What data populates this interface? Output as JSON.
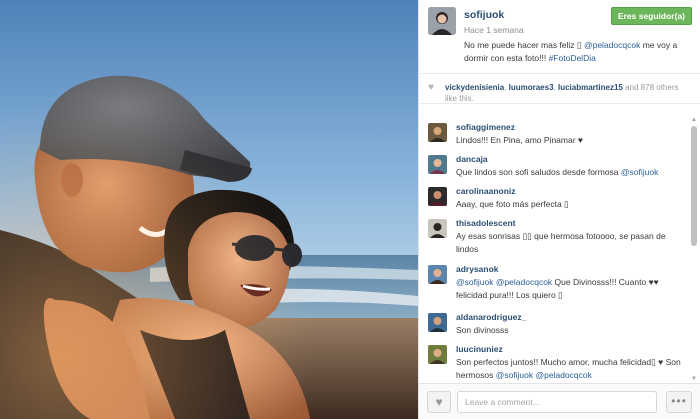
{
  "post": {
    "author": "sofijuok",
    "time": "Hace 1 semana",
    "follow_label": "Eres seguidor(a)",
    "caption": {
      "pre": "No me puede hacer mas feliz ",
      "glyph": "▯",
      "mention": " @peladocqcok",
      "mid": " me voy a dormir con esta foto!!! ",
      "hashtag": "#FotoDelDia"
    }
  },
  "likes": {
    "users": [
      "vickydenisienia",
      "luumoraes3",
      "luciabmartinez15"
    ],
    "sep": ", ",
    "and_text": " and 878 others like this."
  },
  "comments": [
    {
      "user": "sofiaggimenez",
      "text": "Lindos!!! En Pina, amo Pinamar ♥"
    },
    {
      "user": "dancaja",
      "text": "Que lindos son sofi saludos desde formosa ",
      "mention": "@sofijuok"
    },
    {
      "user": "carolinaanoniz",
      "text": "Aaay, que foto más perfecta ▯"
    },
    {
      "user": "thisadolescent",
      "text": "Ay esas sonrisas ▯▯ que hermosa fotoooo, se pasan de lindos"
    },
    {
      "user": "adrysanok",
      "mention": "@sofijuok",
      "mention2": " @peladocqcok",
      "text": " Que Divinosss!!! Cuanto ♥♥ felicidad pura!!! Los quiero ▯"
    },
    {
      "user": "aldanarodriguez_",
      "text": "Son divinosss"
    },
    {
      "user": "luucinuniez",
      "text": "Son perfectos juntos!! Mucho amor, mucha felicidad▯ ♥ Son hermosos ",
      "mention": "@sofijuok",
      "mention2": " @peladocqcok"
    }
  ],
  "footer": {
    "like_icon": "♥",
    "comment_placeholder": "Leave a comment...",
    "more_icon": "•••"
  },
  "colors": {
    "follow_button": "#6bb65a",
    "username": "#2c4e73",
    "link": "#2c5f94"
  }
}
